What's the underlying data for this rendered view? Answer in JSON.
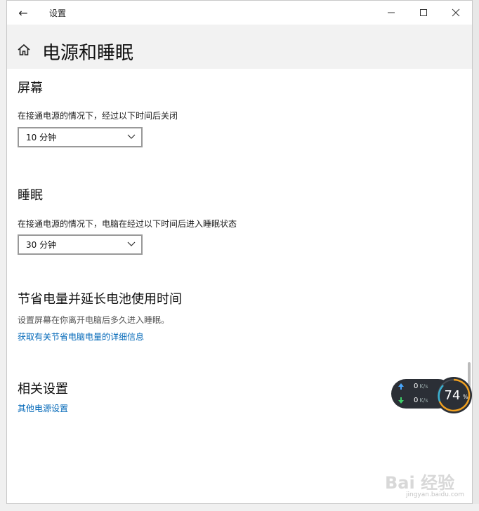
{
  "window": {
    "title": "设置",
    "back_icon": "←",
    "minimize_icon": "—",
    "maximize_icon": "☐",
    "close_icon": "✕"
  },
  "header": {
    "page_title": "电源和睡眠"
  },
  "screen": {
    "heading": "屏幕",
    "description": "在接通电源的情况下，经过以下时间后关闭",
    "selected": "10 分钟"
  },
  "sleep": {
    "heading": "睡眠",
    "description": "在接通电源的情况下，电脑在经过以下时间后进入睡眠状态",
    "selected": "30 分钟"
  },
  "battery": {
    "heading": "节省电量并延长电池使用时间",
    "description": "设置屏幕在你离开电脑后多久进入睡眠。",
    "link": "获取有关节省电脑电量的详细信息"
  },
  "related": {
    "heading": "相关设置",
    "link": "其他电源设置"
  },
  "widget": {
    "upload": "0",
    "download": "0",
    "unit": "K/s",
    "percent": "74",
    "percent_sign": "%"
  },
  "watermark": {
    "text": "Bai 经验",
    "url": "jingyan.baidu.com"
  }
}
